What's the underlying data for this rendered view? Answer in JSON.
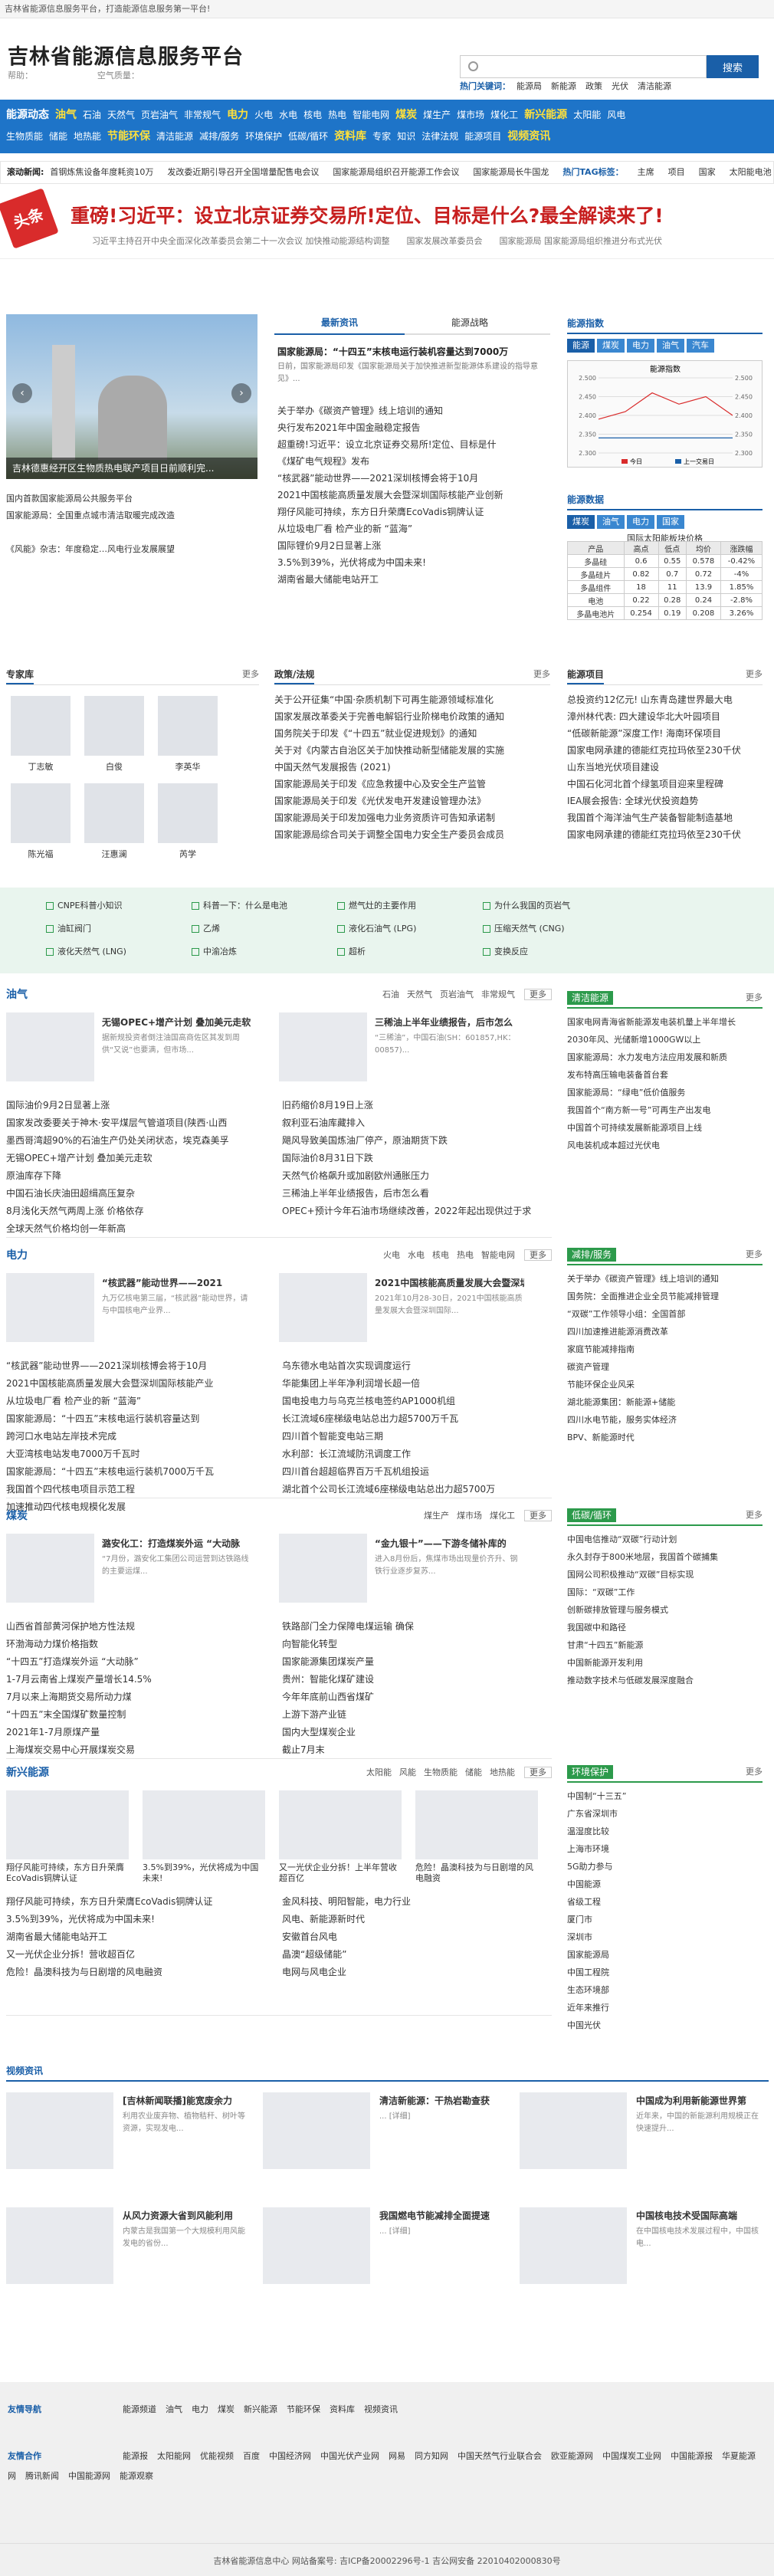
{
  "topbar": "吉林省能源信息服务平台，打造能源信息服务第一平台!",
  "site": {
    "title": "吉林省能源信息服务平台",
    "sub1": "帮助：",
    "sub2": "空气质量："
  },
  "search": {
    "placeholder": "",
    "button": "搜索"
  },
  "hot": {
    "label": "热门关键词：",
    "items": [
      "能源局",
      "新能源",
      "政策",
      "光伏",
      "清洁能源"
    ]
  },
  "nav": {
    "row1": [
      "能源动态",
      "油气",
      "石油",
      "天然气",
      "页岩油气",
      "非常规气",
      "电力",
      "火电",
      "水电",
      "核电",
      "热电",
      "智能电网",
      "煤炭",
      "煤生产",
      "煤市场",
      "煤化工",
      "新兴能源",
      "太阳能",
      "风电"
    ],
    "row2": [
      "生物质能",
      "储能",
      "地热能",
      "节能环保",
      "清洁能源",
      "减排/服务",
      "环境保护",
      "低碳/循环",
      "资料库",
      "专家",
      "知识",
      "法律法规",
      "能源项目",
      "视频资讯"
    ]
  },
  "ticker": {
    "label": "滚动新闻:",
    "items": [
      "首钢炼焦设备年度耗资10万",
      "发改委近期引导召开全国增量配售电会议",
      "国家能源局组织召开能源工作会议",
      "国家能源局长牛国龙"
    ],
    "tag": "热门TAG标签：",
    "tags": [
      "主席",
      "项目",
      "国家",
      "太阳能电池",
      "能源"
    ]
  },
  "headline": {
    "badge": "头条",
    "title": "重磅!习近平：设立北京证券交易所!定位、目标是什么?最全解读来了!",
    "links": [
      "习近平主持召开中央全面深化改革委员会第二十一次会议 加快推动能源结构调整",
      "国家发展改革委员会",
      "国家能源局 国家能源局组织推进分布式光伏"
    ]
  },
  "slider": {
    "caption": "吉林德惠经开区生物质热电联产项目日前顺利完...",
    "items": [
      "国内首款国家能源局公共服务平台",
      "国家能源局：全国重点城市清洁取暖完成改造",
      "《风能》杂志：年度稳定…风电行业发展展望"
    ]
  },
  "tabs": [
    "最新资讯",
    "能源战略"
  ],
  "lead": {
    "title": "国家能源局：“十四五”末核电运行装机容量达到7000万",
    "desc": "日前，国家能源局印发《国家能源局关于加快推进新型能源体系建设的指导意见》..."
  },
  "latest": [
    "关于举办《碳资产管理》线上培训的通知",
    "央行发布2021年中国金融稳定报告",
    "超重磅!习近平：设立北京证券交易所!定位、目标是什",
    "《煤矿电气规程》发布",
    "“核武器”能动世界——2021深圳核博会将于10月",
    "2021中国核能高质量发展大会暨深圳国际核能产业创新",
    "翔仔风能可持续，东方日升荣膺EcoVadis铜牌认证",
    "从垃圾电厂看 检产业的新 “蓝海”",
    "国际锂价9月2日显著上涨",
    "3.5%到39%，光伏将成为中国未来!",
    "湖南省最大储能电站开工"
  ],
  "energyIndex": {
    "title": "能源指数",
    "pills": [
      "能源",
      "煤炭",
      "电力",
      "油气",
      "汽车"
    ],
    "chartTitle": "能源指数",
    "legend": [
      "今日",
      "上一交易日"
    ]
  },
  "chart_data": {
    "type": "line",
    "title": "能源指数",
    "yaxis": [
      2.3,
      2.35,
      2.4,
      2.45,
      2.5
    ],
    "x": [
      "9:30",
      "10:30",
      "11:30",
      "13:00",
      "14:00",
      "15:00"
    ],
    "series": [
      {
        "name": "今日",
        "values": [
          2.39,
          2.41,
          2.46,
          2.43,
          2.45,
          2.4
        ]
      },
      {
        "name": "上一交易日",
        "values": [
          2.34,
          2.34,
          2.34,
          2.34,
          2.34,
          2.34
        ]
      }
    ]
  },
  "energyData": {
    "title": "能源数据",
    "pills": [
      "煤炭",
      "油气",
      "电力",
      "国家"
    ],
    "tableTitle": "国际太阳能板块价格",
    "headers": [
      "产品",
      "高点",
      "低点",
      "均价",
      "涨跌幅"
    ],
    "rows": [
      [
        "多晶硅",
        "0.6",
        "0.55",
        "0.578",
        "-0.42%"
      ],
      [
        "多晶硅片",
        "0.82",
        "0.7",
        "0.72",
        "-4%"
      ],
      [
        "多晶组件",
        "18",
        "11",
        "13.9",
        "1.85%"
      ],
      [
        "电池",
        "0.22",
        "0.28",
        "0.24",
        "-2.8%"
      ],
      [
        "多晶电池片",
        "0.254",
        "0.19",
        "0.208",
        "3.26%"
      ]
    ]
  },
  "experts": {
    "title": "专家库",
    "more": "更多",
    "people": [
      "丁志敏",
      "白俊",
      "李英华",
      "陈光福",
      "汪惠澜",
      "芮学"
    ]
  },
  "policy": {
    "title": "政策/法规",
    "more": "更多",
    "items": [
      "关于公开征集“中国·杂质机制下可再生能源领域标准化",
      "国家发展改革委关于完善电解铝行业阶梯电价政策的通知",
      "国务院关于印发《“十四五”就业促进规划》的通知",
      "关于对《内蒙古自治区关于加快推动新型储能发展的实施",
      "中国天然气发展报告 (2021)",
      "国家能源局关于印发《应急救援中心及安全生产监管",
      "国家能源局关于印发《光伏发电开发建设管理办法》",
      "国家能源局关于印发加强电力业务资质许可告知承诺制",
      "国家能源局综合司关于调整全国电力安全生产委员会成员"
    ]
  },
  "projects": {
    "title": "能源项目",
    "more": "更多",
    "items": [
      "总投资约12亿元! 山东青岛建世界最大电",
      "漳州林代表: 四大建设华北大叶园项目",
      "“低碳新能源”深度工作! 海南环保项目",
      "国家电网承建的德能红克拉玛依至230千伏",
      "山东当地光伏项目建设",
      "中国石化河北首个绿氢项目迎来里程碑",
      "IEA展会报告: 全球光伏投资趋势",
      "我国首个海洋油气生产装备智能制造基地",
      "国家电网承建的德能红克拉玛依至230千伏"
    ]
  },
  "greenLinks": [
    "CNPE科普小知识",
    "科普一下：什么是电池",
    "燃气灶的主要作用",
    "为什么我国的页岩气",
    "油缸阀门",
    "乙烯",
    "液化石油气 (LPG)",
    "压缩天然气 (CNG)",
    "液化天然气 (LNG)",
    "中渝冶炼",
    "超析",
    "变换反应"
  ],
  "oil": {
    "title": "油气",
    "tabs": [
      "石油",
      "天然气",
      "页岩油气",
      "非常规气"
    ],
    "more": "更多",
    "cards": [
      {
        "t": "无锡OPEC+增产计划 叠加美元走软",
        "d": "据新规投资者倒注油国高商佐区其发到周供“又说”也要满，但市场..."
      },
      {
        "t": "三稀油上半年业绩报告，后市怎么",
        "d": "“三稀油”，中国石油(SH：601857,HK：00857)..."
      }
    ],
    "left": [
      "国际油价9月2日显著上涨",
      "国家发改委要关于神木·安平煤层气管道项目(陕西·山西",
      "墨西哥湾超90%的石油生产仍处关闭状态，埃克森美孚",
      "无锡OPEC+增产计划 叠加美元走软",
      "原油库存下降",
      "中国石油长庆油田超缉高压复杂",
      "8月浅化天然气两周上涨 价格依存",
      "全球天然气价格均创一年新高"
    ],
    "right": [
      "旧药缩价8月19日上涨",
      "叙利亚石油库藏排入",
      "飓风导致美国炼油厂停产，原油期货下跌",
      "国际油价8月31日下跌",
      "天然气价格飙升或加剧欧州通胀压力",
      "三稀油上半年业绩报告，后市怎么看",
      "OPEC+预计今年石油市场继续改善，2022年起出现供过于求"
    ]
  },
  "green1": {
    "title": "清洁能源",
    "more": "更多",
    "items": [
      "国家电网青海省新能源发电装机量上半年增长",
      "2030年风、光储新增1000GW以上",
      "国家能源局：水力发电方法应用发展和新质",
      "发布特高压输电装备首台套",
      "国家能源局：“绿电”低价值服务",
      "我国首个“南方新一号”可再生产出发电",
      "中国首个可持续发展新能源项目上线",
      "风电装机成本超过光伏电"
    ]
  },
  "power": {
    "title": "电力",
    "tabs": [
      "火电",
      "水电",
      "核电",
      "热电",
      "智能电网"
    ],
    "more": "更多",
    "cards": [
      {
        "t": "“核武器”能动世界——2021",
        "d": "九万亿核电第三届，“核武器”能动世界，请与中国核电产业界..."
      },
      {
        "t": "2021中国核能高质量发展大会暨深圳",
        "d": "2021年10月28-30日，2021中国核能高质量发展大会暨深圳国际..."
      }
    ],
    "left": [
      "“核武器”能动世界——2021深圳核博会将于10月",
      "2021中国核能高质量发展大会暨深圳国际核能产业",
      "从垃圾电厂看 检产业的新 “蓝海”",
      "国家能源局：“十四五”末核电运行装机容量达到",
      "跨河口水电站左岸技术完成",
      "大亚湾核电站发电7000万千瓦时",
      "国家能源局：“十四五”末核电运行装机7000万千瓦",
      "我国首个四代核电项目示范工程",
      "加速推动四代核电规模化发展"
    ],
    "right": [
      "乌东德水电站首次实现调度运行",
      "华能集团上半年净利润增长超一倍",
      "国电投电力与乌克兰核电签约AP1000机组",
      "长江流域6座梯级电站总出力超5700万千瓦",
      "四川首个智能变电站三期",
      "水利部：长江流域防汛调度工作",
      "四川首台超超临界百万千瓦机组投运",
      "湖北首个公司长江流域6座梯级电站总出力超5700万"
    ]
  },
  "energySave": {
    "title": "减排/服务",
    "more": "更多",
    "items": [
      "关于举办《碳资产管理》线上培训的通知",
      "国务院：全面推进企业全员节能减排管理",
      "“双碳”工作领导小组：全国首部",
      "四川加速推进能源消费改革",
      "家庭节能减排指南",
      "碳资产管理",
      "节能环保企业风采",
      "湖北能源集团：新能源+储能",
      "四川水电节能，服务实体经济",
      "BPV、新能源时代"
    ]
  },
  "coal": {
    "title": "煤炭",
    "tabs": [
      "煤生产",
      "煤市场",
      "煤化工"
    ],
    "more": "更多",
    "cards": [
      {
        "t": "潞安化工：打造煤炭外运 “大动脉",
        "d": "“7月份，潞安化工集团公司运营到达铁路线的主要运煤..."
      },
      {
        "t": "“金九银十”——下游冬储补库的",
        "d": "进入8月份后，焦煤市场出现量价齐升、钢铁行业逐步复苏..."
      }
    ],
    "left": [
      "山西省首部黄河保护地方性法规",
      "环渤海动力煤价格指数",
      "“十四五”打造煤炭外运 “大动脉”",
      "1-7月云南省上煤炭产量增长14.5%",
      "7月以来上海期货交易所动力煤",
      "“十四五”末全国煤矿数量控制",
      "2021年1-7月原煤产量",
      "上海煤炭交易中心开展煤炭交易"
    ],
    "right": [
      "铁路部门全力保障电煤运输 确保",
      "向智能化转型",
      "国家能源集团煤炭产量",
      "贵州：智能化煤矿建设",
      "今年年底前山西省煤矿",
      "上游下游产业链",
      "国内大型煤炭企业",
      "截止7月末"
    ]
  },
  "lowcarbon": {
    "title": "低碳/循环",
    "more": "更多",
    "items": [
      "中国电信推动“双碳”行动计划",
      "永久封存于800米地层，我国首个碳捕集",
      "国网公司积极推动“双碳”目标实现",
      "国际：“双碳”工作",
      "创新碳排放管理与服务模式",
      "我国碳中和路径",
      "甘肃“十四五”新能源",
      "中国新能源开发利用",
      "推动数字技术与低碳发展深度融合"
    ]
  },
  "newenergy": {
    "title": "新兴能源",
    "tabs": [
      "太阳能",
      "风能",
      "生物质能",
      "储能",
      "地热能"
    ],
    "more": "更多",
    "cards": [
      {
        "t": "",
        "d": "翔仔风能可持续，东方日升荣膺EcoVadis铜牌认证"
      },
      {
        "t": "",
        "d": "3.5%到39%，光伏将成为中国未来!"
      },
      {
        "t": "",
        "d": "又一光伏企业分拆！上半年营收超百亿"
      },
      {
        "t": "",
        "d": "危险！晶澳科技为与日剧增的风电融资"
      }
    ],
    "left": [
      "翔仔风能可持续，东方日升荣膺EcoVadis铜牌认证",
      "3.5%到39%，光伏将成为中国未来!",
      "湖南省最大储能电站开工",
      "又一光伏企业分拆！营收超百亿",
      "危险！晶澳科技为与日剧增的风电融资"
    ],
    "right": [
      "金风科技、明阳智能，电力行业",
      "风电、新能源新时代",
      "安徽首台风电",
      "晶澳“超级储能”",
      "电网与风电企业"
    ]
  },
  "envprotect": {
    "title": "环境保护",
    "more": "更多",
    "items": [
      "中国制“十三五”",
      "广东省深圳市",
      "温湿度比较",
      "上海市环境",
      "5G助力参与",
      "中国能源",
      "省级工程",
      "厦门市",
      "深圳市",
      "国家能源局",
      "中国工程院",
      "生态环境部",
      "近年来推行",
      "中国光伏"
    ]
  },
  "video": {
    "title": "视频资讯",
    "cards": [
      {
        "t": "[吉林新闻联播]能宽废余力",
        "d": "利用农业废弃物、植物秸秆、树叶等资源，实现发电..."
      },
      {
        "t": "清洁新能源：干热岩勘查获",
        "d": "... [详细]"
      },
      {
        "t": "中国成为利用新能源世界第",
        "d": "近年来，中国的新能源利用规模正在快速提升..."
      },
      {
        "t": "从风力资源大省到风能利用",
        "d": "内蒙古是我国第一个大规模利用风能发电的省份..."
      },
      {
        "t": "我国燃电节能减排全面提速",
        "d": "... [详细]"
      },
      {
        "t": "中国核电技术受国际高端",
        "d": "在中国核电技术发展过程中，中国核电..."
      }
    ]
  },
  "footer": {
    "label1": "友情导航",
    "links1": [
      "能源频道",
      "油气",
      "电力",
      "煤炭",
      "新兴能源",
      "节能环保",
      "资料库",
      "视频资讯"
    ],
    "label2": "友情合作",
    "links2": [
      "能源报",
      "太阳能网",
      "优能视频",
      "百度",
      "中国经济网",
      "中国光伏产业网",
      "网易",
      "同方知网",
      "中国天然气行业联合会",
      "欧亚能源网",
      "中国煤炭工业网",
      "中国能源报",
      "华夏能源网",
      "腾讯新闻",
      "中国能源网",
      "能源观察"
    ],
    "copy": "吉林省能源信息中心  网站备案号: 吉ICP备20002296号-1  吉公网安备 22010402000830号"
  }
}
